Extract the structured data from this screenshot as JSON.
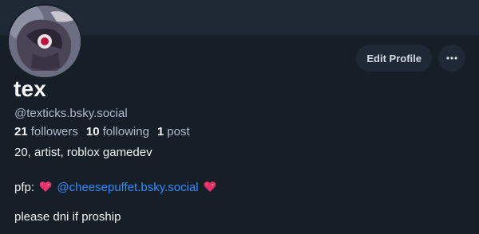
{
  "profile": {
    "display_name": "tex",
    "handle": "@texticks.bsky.social",
    "stats": {
      "followers_count": "21",
      "followers_label": "followers",
      "following_count": "10",
      "following_label": "following",
      "posts_count": "1",
      "posts_label": "post"
    },
    "bio": {
      "line1": "20, artist, roblox gamedev",
      "line2_prefix": "pfp:",
      "line2_mention": "@cheesepuffet.bsky.social",
      "line3": "please dni if proship"
    }
  },
  "actions": {
    "edit_label": "Edit Profile",
    "more_icon": "ellipsis-icon"
  },
  "colors": {
    "background": "#161e27",
    "banner": "#1e2935",
    "link": "#2e8cff"
  },
  "icons": [
    "avatar-image",
    "sparkling-heart-icon",
    "ellipsis-icon"
  ]
}
